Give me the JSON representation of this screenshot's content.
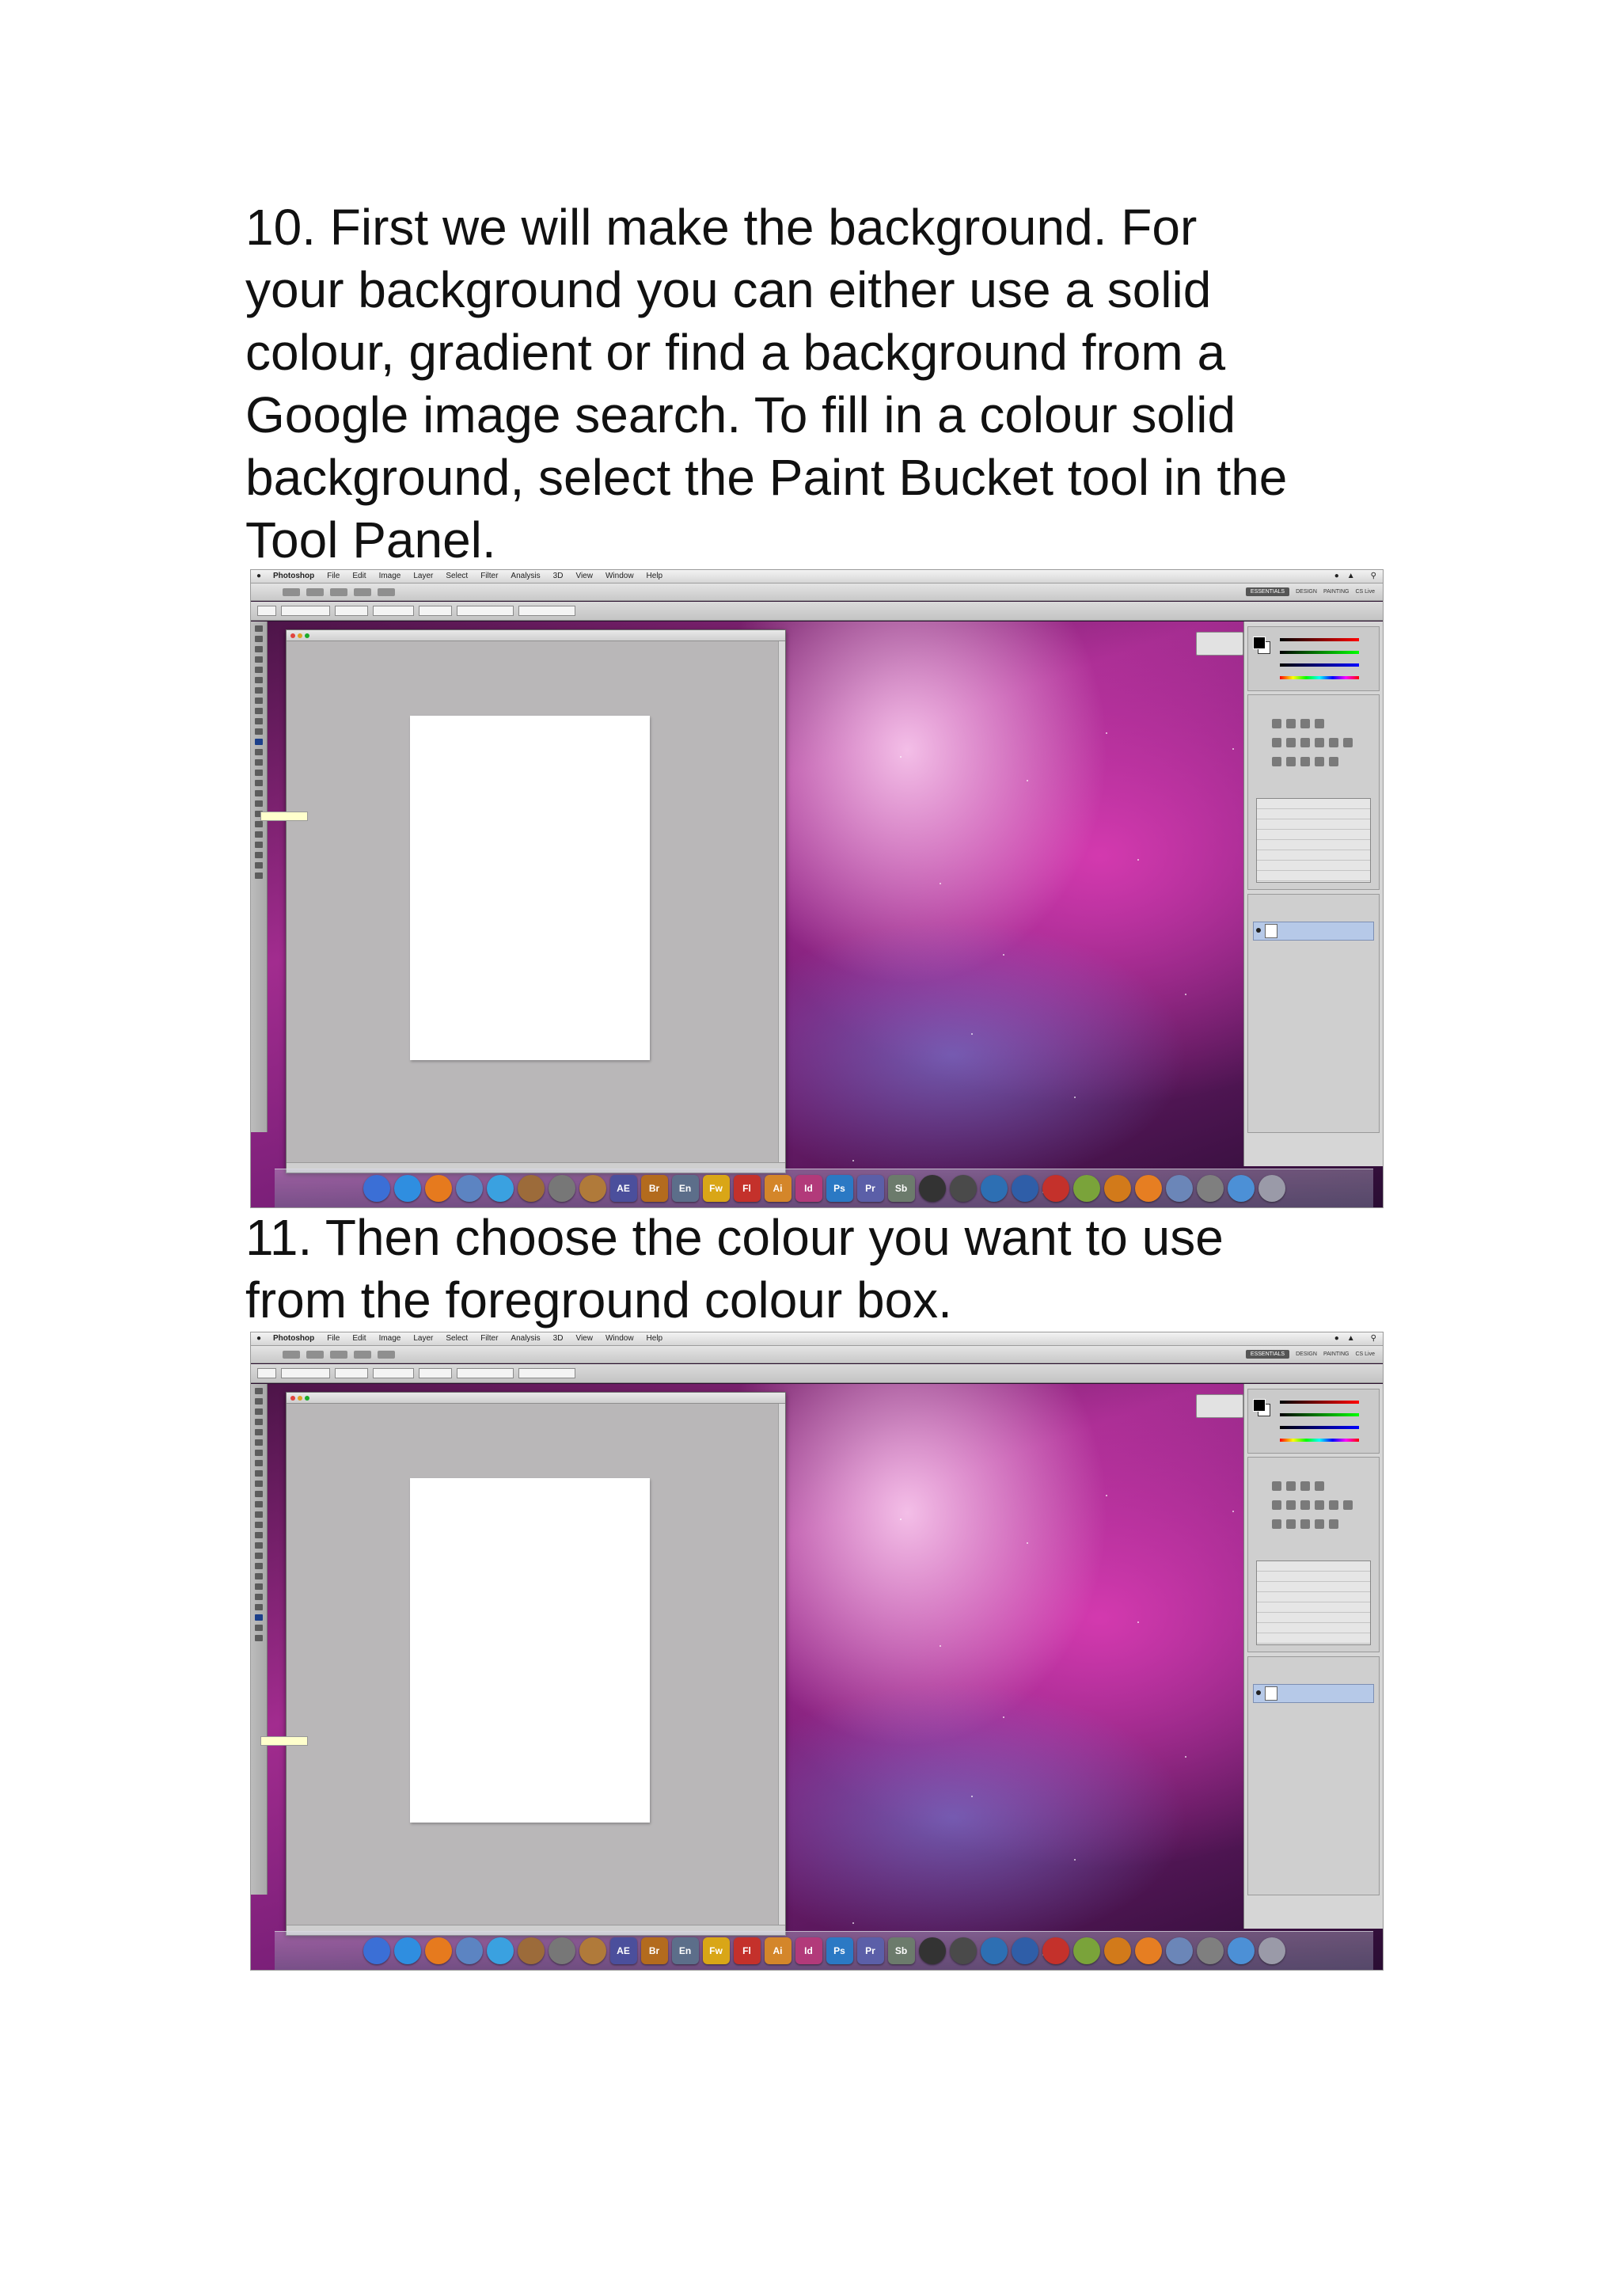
{
  "step10": {
    "lines": [
      "10. First we will make the background. For",
      "your background you can either use a solid",
      "colour, gradient or find a background from a",
      "Google image search. To fill in a colour solid",
      "background, select the Paint Bucket tool in the",
      "Tool Panel."
    ]
  },
  "step11": {
    "lines": [
      "11. Then choose the colour you want to use",
      "from the foreground colour box."
    ]
  },
  "screenshot": {
    "menubar": [
      "Photoshop",
      "File",
      "Edit",
      "Image",
      "Layer",
      "Select",
      "Filter",
      "Analysis",
      "3D",
      "View",
      "Window",
      "Help"
    ],
    "workspace": {
      "active": "ESSENTIALS",
      "others": [
        "DESIGN",
        "PAINTING"
      ],
      "search_placeholder": "CS Live"
    },
    "dock_icons": [
      {
        "label": "",
        "icon": "finder-icon",
        "color": "#3b6fd6"
      },
      {
        "label": "",
        "icon": "safari-icon",
        "color": "#2f8ee0"
      },
      {
        "label": "",
        "icon": "firefox-icon",
        "color": "#e67a1e"
      },
      {
        "label": "",
        "icon": "mail-icon",
        "color": "#5c84c2"
      },
      {
        "label": "",
        "icon": "itunes-icon",
        "color": "#3aa1e0"
      },
      {
        "label": "",
        "icon": "photos-icon",
        "color": "#9c6b3a"
      },
      {
        "label": "",
        "icon": "garageband-icon",
        "color": "#777777"
      },
      {
        "label": "",
        "icon": "guitar-icon",
        "color": "#b07a3a"
      },
      {
        "label": "AE",
        "icon": "after-effects-icon",
        "color": "#4b4f9c"
      },
      {
        "label": "Br",
        "icon": "bridge-icon",
        "color": "#b36b1e"
      },
      {
        "label": "En",
        "icon": "encore-icon",
        "color": "#5c6e8a"
      },
      {
        "label": "Fw",
        "icon": "fireworks-icon",
        "color": "#d9a617"
      },
      {
        "label": "Fl",
        "icon": "flash-icon",
        "color": "#c4312b"
      },
      {
        "label": "Ai",
        "icon": "illustrator-icon",
        "color": "#d4862a"
      },
      {
        "label": "Id",
        "icon": "indesign-icon",
        "color": "#b23a7a"
      },
      {
        "label": "Ps",
        "icon": "photoshop-icon",
        "color": "#2b79c4"
      },
      {
        "label": "Pr",
        "icon": "premiere-icon",
        "color": "#5b5fa8"
      },
      {
        "label": "Sb",
        "icon": "soundbooth-icon",
        "color": "#6c7b6c"
      },
      {
        "label": "",
        "icon": "dvd-player-icon",
        "color": "#333333"
      },
      {
        "label": "",
        "icon": "clapper-icon",
        "color": "#4a4a4a"
      },
      {
        "label": "",
        "icon": "quicktime-icon",
        "color": "#2d6fb3"
      },
      {
        "label": "",
        "icon": "word-icon",
        "color": "#2f5ea8"
      },
      {
        "label": "",
        "icon": "acrobat-icon",
        "color": "#c4312b"
      },
      {
        "label": "",
        "icon": "dashboard-icon",
        "color": "#7aa33a"
      },
      {
        "label": "",
        "icon": "office-icon",
        "color": "#d27a1a"
      },
      {
        "label": "",
        "icon": "vlc-icon",
        "color": "#e67e22"
      },
      {
        "label": "",
        "icon": "preview-icon",
        "color": "#6b86b8"
      },
      {
        "label": "",
        "icon": "system-preferences-icon",
        "color": "#7f7f7f"
      },
      {
        "label": "",
        "icon": "downloads-icon",
        "color": "#4c90d6"
      },
      {
        "label": "",
        "icon": "trash-icon",
        "color": "#9a9aa8"
      }
    ],
    "colors": {
      "doc_gray": "#b9b7b8",
      "desktop_magenta": "#a22c8f",
      "selected_layer": "#b6c9e8"
    }
  }
}
